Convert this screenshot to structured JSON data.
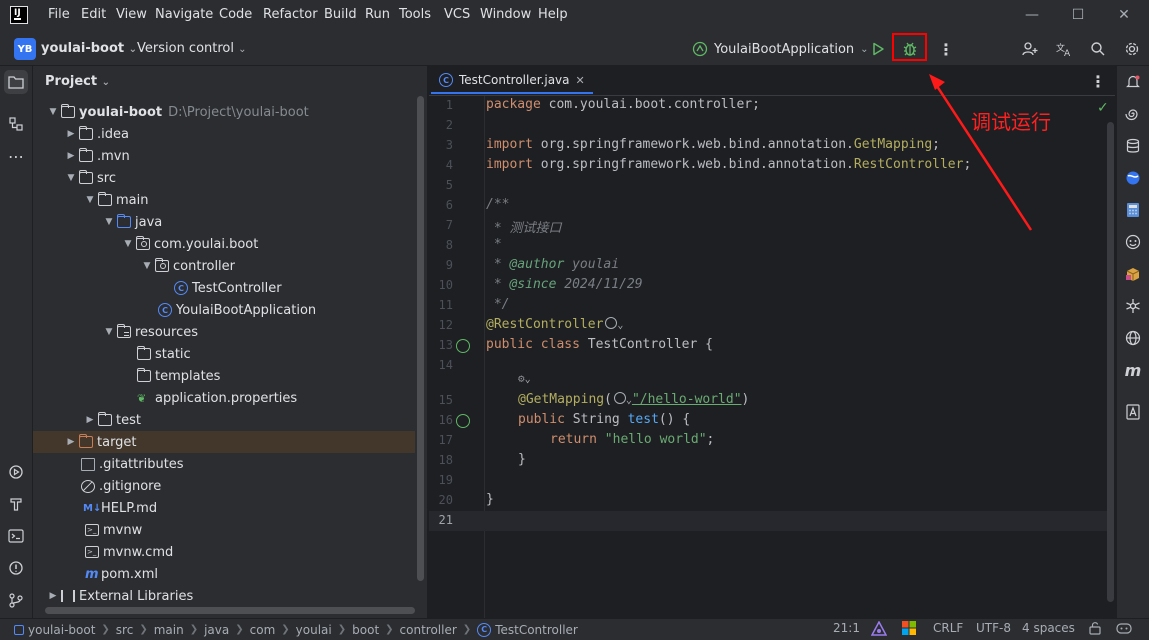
{
  "menu": {
    "items": [
      "File",
      "Edit",
      "View",
      "Navigate",
      "Code",
      "Refactor",
      "Build",
      "Run",
      "Tools",
      "VCS",
      "Window",
      "Help"
    ]
  },
  "window_controls": {
    "minimize": "—",
    "maximize": "☐",
    "close": "✕"
  },
  "toolbar": {
    "project_badge": "YB",
    "project_name": "youlai-boot",
    "vcs_label": "Version control",
    "run_config": "YoulaiBootApplication",
    "run_icon": "play-icon",
    "debug_icon": "bug-icon"
  },
  "annotation": {
    "text": "调试运行",
    "color": "#ff0000"
  },
  "project_panel": {
    "title": "Project",
    "root_name": "youlai-boot",
    "root_path": "D:\\Project\\youlai-boot",
    "nodes": [
      {
        "label": ".idea",
        "icon": "folder-icon"
      },
      {
        "label": ".mvn",
        "icon": "folder-icon"
      },
      {
        "label": "src",
        "icon": "folder-icon"
      },
      {
        "label": "main",
        "icon": "folder-icon"
      },
      {
        "label": "java",
        "icon": "source-folder-icon"
      },
      {
        "label": "com.youlai.boot",
        "icon": "package-icon"
      },
      {
        "label": "controller",
        "icon": "package-icon"
      },
      {
        "label": "TestController",
        "icon": "class-icon"
      },
      {
        "label": "YoulaiBootApplication",
        "icon": "spring-boot-icon"
      },
      {
        "label": "resources",
        "icon": "resources-folder-icon"
      },
      {
        "label": "static",
        "icon": "folder-icon"
      },
      {
        "label": "templates",
        "icon": "folder-icon"
      },
      {
        "label": "application.properties",
        "icon": "spring-properties-icon"
      },
      {
        "label": "test",
        "icon": "folder-icon"
      },
      {
        "label": "target",
        "icon": "excluded-folder-icon"
      },
      {
        "label": ".gitattributes",
        "icon": "file-icon"
      },
      {
        "label": ".gitignore",
        "icon": "ignore-file-icon"
      },
      {
        "label": "HELP.md",
        "icon": "markdown-icon"
      },
      {
        "label": "mvnw",
        "icon": "terminal-file-icon"
      },
      {
        "label": "mvnw.cmd",
        "icon": "terminal-file-icon"
      },
      {
        "label": "pom.xml",
        "icon": "maven-icon"
      },
      {
        "label": "External Libraries",
        "icon": "library-icon"
      }
    ]
  },
  "editor": {
    "tab_label": "TestController.java",
    "line_numbers": [
      "1",
      "2",
      "3",
      "4",
      "5",
      "6",
      "7",
      "8",
      "9",
      "10",
      "11",
      "12",
      "13",
      "14",
      "15",
      "16",
      "17",
      "18",
      "19",
      "20",
      "21"
    ],
    "code": {
      "l1a": "package",
      "l1b": " com.youlai.boot.controller;",
      "l3a": "import",
      "l3b": " org.springframework.web.bind.annotation.",
      "l3c": "GetMapping",
      "l3d": ";",
      "l4a": "import",
      "l4b": " org.springframework.web.bind.annotation.",
      "l4c": "RestController",
      "l4d": ";",
      "l6": "/**",
      "l7": " * 测试接口",
      "l8": " *",
      "l9a": " * ",
      "l9b": "@author",
      "l9c": " youlai",
      "l10a": " * ",
      "l10b": "@since",
      "l10c": " 2024/11/29",
      "l11": " */",
      "l12": "@RestController",
      "l13a": "public class",
      "l13b": " TestController {",
      "l15a": "@GetMapping",
      "l15b": "(",
      "l15c": "\"/hello-world\"",
      "l15d": ")",
      "l16a": "public",
      "l16b": " String ",
      "l16c": "test",
      "l16d": "() {",
      "l17a": "return",
      "l17b": "\"hello world\"",
      "l17c": ";",
      "l18": "}",
      "l20": "}"
    }
  },
  "status_bar": {
    "breadcrumbs": [
      "youlai-boot",
      "src",
      "main",
      "java",
      "com",
      "youlai",
      "boot",
      "controller",
      "TestController"
    ],
    "position": "21:1",
    "line_ending": "CRLF",
    "encoding": "UTF-8",
    "indent": "4 spaces"
  }
}
